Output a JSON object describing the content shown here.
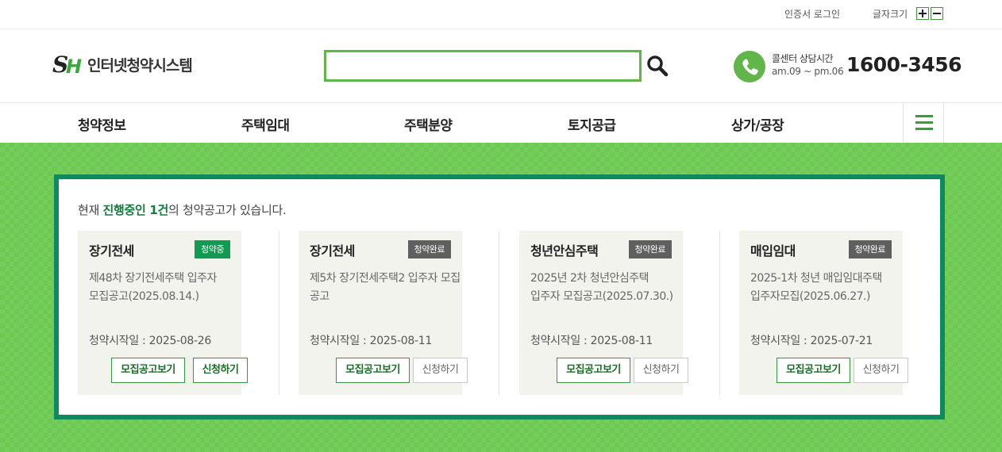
{
  "topbar": {
    "cert_login": "인증서 로그인",
    "font_size_label": "글자크기"
  },
  "header": {
    "logo_text": "인터넷청약시스템",
    "search_placeholder": "",
    "call_center_label": "콜센터 상담시간",
    "call_center_hours": "am.09 ~ pm.06",
    "phone_number": "1600-3456"
  },
  "nav": {
    "items": [
      "청약정보",
      "주택임대",
      "주택분양",
      "토지공급",
      "상가/공장"
    ]
  },
  "notice": {
    "summary_prefix": "현재 ",
    "summary_highlight": "진행중인 1건",
    "summary_suffix": "의 청약공고가 있습니다.",
    "cards": [
      {
        "type": "장기전세",
        "status": "청약중",
        "title": "제48차 장기전세주택 입주자 모집공고(2025.08.14.)",
        "date": "청약시작일 : 2025-08-26",
        "notice_button": "모집공고보기",
        "apply_button": "신청하기"
      },
      {
        "type": "장기전세",
        "status": "청약완료",
        "title": "제5차 장기전세주택2 입주자 모집 공고",
        "date": "청약시작일 : 2025-08-11",
        "notice_button": "모집공고보기",
        "apply_button": "신청하기"
      },
      {
        "type": "청년안심주택",
        "status": "청약완료",
        "title": "2025년 2차 청년안심주택 입주자 모집공고(2025.07.30.)",
        "date": "청약시작일 : 2025-08-11",
        "notice_button": "모집공고보기",
        "apply_button": "신청하기"
      },
      {
        "type": "매입임대",
        "status": "청약완료",
        "title": "2025-1차 청년 매입임대주택 입주자모집(2025.06.27.)",
        "date": "청약시작일 : 2025-07-21",
        "notice_button": "모집공고보기",
        "apply_button": "신청하기"
      }
    ]
  },
  "colors": {
    "brand_green": "#62b548",
    "dark_green": "#0d8a5e",
    "status_active": "#119a51",
    "status_closed": "#5f5f5f"
  }
}
